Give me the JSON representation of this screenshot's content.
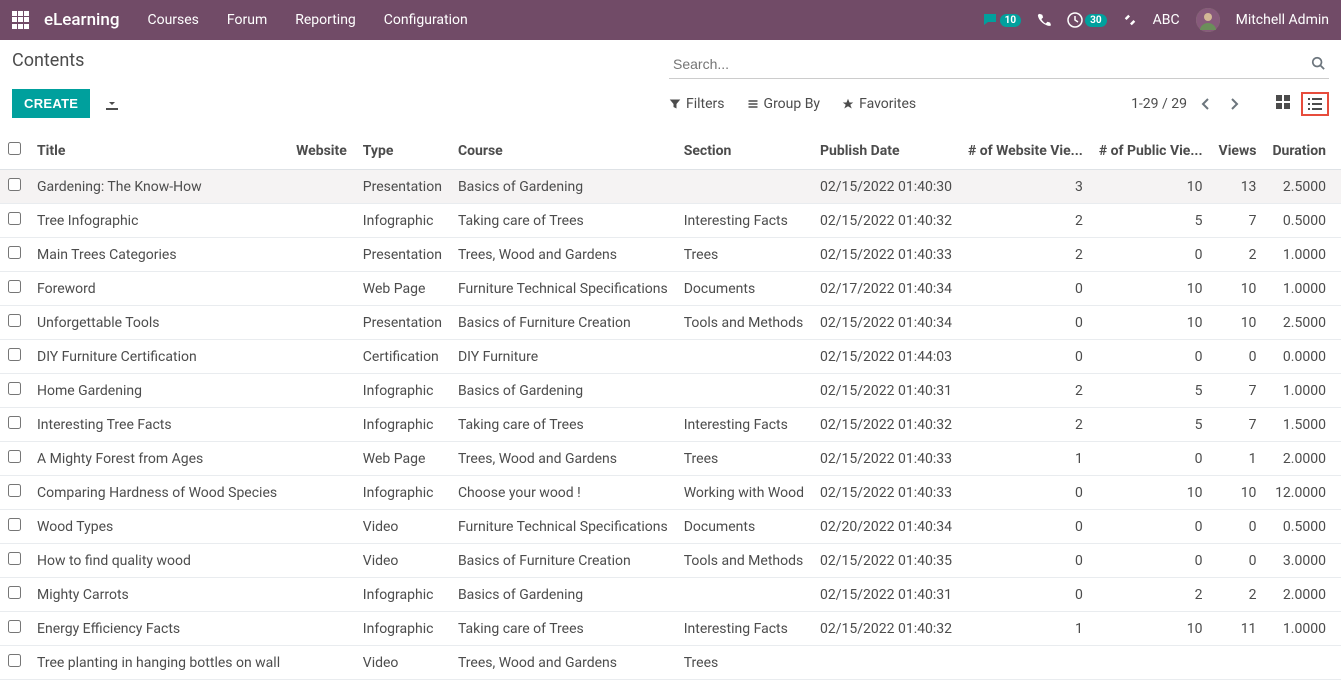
{
  "topbar": {
    "brand": "eLearning",
    "menu": [
      "Courses",
      "Forum",
      "Reporting",
      "Configuration"
    ],
    "messages_badge": "10",
    "activities_badge": "30",
    "company": "ABC",
    "user_name": "Mitchell Admin"
  },
  "breadcrumb": "Contents",
  "search": {
    "placeholder": "Search..."
  },
  "buttons": {
    "create": "CREATE"
  },
  "filters": {
    "filters": "Filters",
    "group_by": "Group By",
    "favorites": "Favorites"
  },
  "pager": {
    "text": "1-29 / 29"
  },
  "columns": {
    "title": "Title",
    "website": "Website",
    "type": "Type",
    "course": "Course",
    "section": "Section",
    "publish_date": "Publish Date",
    "website_views": "# of Website Vie...",
    "public_views": "# of Public Vie...",
    "views": "Views",
    "duration": "Duration"
  },
  "rows": [
    {
      "title": "Gardening: The Know-How",
      "website": "",
      "type": "Presentation",
      "course": "Basics of Gardening",
      "section": "",
      "publish_date": "02/15/2022 01:40:30",
      "website_views": "3",
      "public_views": "10",
      "views": "13",
      "duration": "2.5000"
    },
    {
      "title": "Tree Infographic",
      "website": "",
      "type": "Infographic",
      "course": "Taking care of Trees",
      "section": "Interesting Facts",
      "publish_date": "02/15/2022 01:40:32",
      "website_views": "2",
      "public_views": "5",
      "views": "7",
      "duration": "0.5000"
    },
    {
      "title": "Main Trees Categories",
      "website": "",
      "type": "Presentation",
      "course": "Trees, Wood and Gardens",
      "section": "Trees",
      "publish_date": "02/15/2022 01:40:33",
      "website_views": "2",
      "public_views": "0",
      "views": "2",
      "duration": "1.0000"
    },
    {
      "title": "Foreword",
      "website": "",
      "type": "Web Page",
      "course": "Furniture Technical Specifications",
      "section": "Documents",
      "publish_date": "02/17/2022 01:40:34",
      "website_views": "0",
      "public_views": "10",
      "views": "10",
      "duration": "1.0000"
    },
    {
      "title": "Unforgettable Tools",
      "website": "",
      "type": "Presentation",
      "course": "Basics of Furniture Creation",
      "section": "Tools and Methods",
      "publish_date": "02/15/2022 01:40:34",
      "website_views": "0",
      "public_views": "10",
      "views": "10",
      "duration": "2.5000"
    },
    {
      "title": "DIY Furniture Certification",
      "website": "",
      "type": "Certification",
      "course": "DIY Furniture",
      "section": "",
      "publish_date": "02/15/2022 01:44:03",
      "website_views": "0",
      "public_views": "0",
      "views": "0",
      "duration": "0.0000"
    },
    {
      "title": "Home Gardening",
      "website": "",
      "type": "Infographic",
      "course": "Basics of Gardening",
      "section": "",
      "publish_date": "02/15/2022 01:40:31",
      "website_views": "2",
      "public_views": "5",
      "views": "7",
      "duration": "1.0000"
    },
    {
      "title": "Interesting Tree Facts",
      "website": "",
      "type": "Infographic",
      "course": "Taking care of Trees",
      "section": "Interesting Facts",
      "publish_date": "02/15/2022 01:40:32",
      "website_views": "2",
      "public_views": "5",
      "views": "7",
      "duration": "1.5000"
    },
    {
      "title": "A Mighty Forest from Ages",
      "website": "",
      "type": "Web Page",
      "course": "Trees, Wood and Gardens",
      "section": "Trees",
      "publish_date": "02/15/2022 01:40:33",
      "website_views": "1",
      "public_views": "0",
      "views": "1",
      "duration": "2.0000"
    },
    {
      "title": "Comparing Hardness of Wood Species",
      "website": "",
      "type": "Infographic",
      "course": "Choose your wood !",
      "section": "Working with Wood",
      "publish_date": "02/15/2022 01:40:33",
      "website_views": "0",
      "public_views": "10",
      "views": "10",
      "duration": "12.0000"
    },
    {
      "title": "Wood Types",
      "website": "",
      "type": "Video",
      "course": "Furniture Technical Specifications",
      "section": "Documents",
      "publish_date": "02/20/2022 01:40:34",
      "website_views": "0",
      "public_views": "0",
      "views": "0",
      "duration": "0.5000"
    },
    {
      "title": "How to find quality wood",
      "website": "",
      "type": "Video",
      "course": "Basics of Furniture Creation",
      "section": "Tools and Methods",
      "publish_date": "02/15/2022 01:40:35",
      "website_views": "0",
      "public_views": "0",
      "views": "0",
      "duration": "3.0000"
    },
    {
      "title": "Mighty Carrots",
      "website": "",
      "type": "Infographic",
      "course": "Basics of Gardening",
      "section": "",
      "publish_date": "02/15/2022 01:40:31",
      "website_views": "0",
      "public_views": "2",
      "views": "2",
      "duration": "2.0000"
    },
    {
      "title": "Energy Efficiency Facts",
      "website": "",
      "type": "Infographic",
      "course": "Taking care of Trees",
      "section": "Interesting Facts",
      "publish_date": "02/15/2022 01:40:32",
      "website_views": "1",
      "public_views": "10",
      "views": "11",
      "duration": "1.0000"
    },
    {
      "title": "Tree planting in hanging bottles on wall",
      "website": "",
      "type": "Video",
      "course": "Trees, Wood and Gardens",
      "section": "Trees",
      "publish_date": "",
      "website_views": "",
      "public_views": "",
      "views": "",
      "duration": ""
    }
  ]
}
